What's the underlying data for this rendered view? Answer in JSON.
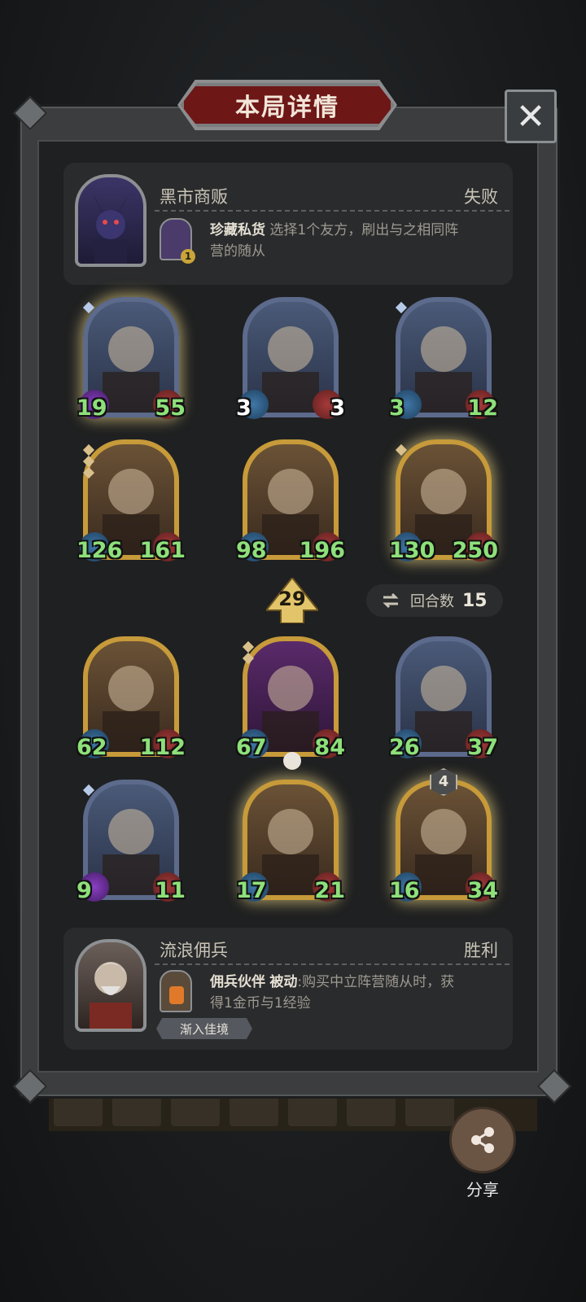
{
  "title": "本局详情",
  "close_label": "✕",
  "opponent": {
    "name": "黑市商贩",
    "result": "失败",
    "power_name": "珍藏私货",
    "power_desc_line1": "选择1个友方，刷出与之相同阵",
    "power_desc_line2": "营的随从",
    "power_badge": "1"
  },
  "board_top": [
    {
      "atk": "19",
      "hp": "55",
      "frame": "silver",
      "glow": true,
      "atk_style": "purple",
      "diamonds": 1
    },
    {
      "atk": "3",
      "hp": "3",
      "frame": "silver",
      "glow": false,
      "atk_style": "blue",
      "atk_white": true,
      "hp_white": true,
      "diamonds": 0
    },
    {
      "atk": "3",
      "hp": "12",
      "frame": "silver",
      "glow": false,
      "atk_style": "red",
      "diamonds": 1
    },
    {
      "atk": "126",
      "hp": "161",
      "frame": "gold",
      "glow": false,
      "diamonds": 3
    },
    {
      "atk": "98",
      "hp": "196",
      "frame": "gold",
      "glow": false,
      "diamonds": 0
    },
    {
      "atk": "130",
      "hp": "250",
      "frame": "gold",
      "glow": true,
      "diamonds": 1
    }
  ],
  "tier": "29",
  "turns": {
    "label": "回合数",
    "value": "15"
  },
  "board_bottom": [
    {
      "atk": "62",
      "hp": "112",
      "frame": "gold",
      "glow": false,
      "diamonds": 0
    },
    {
      "atk": "67",
      "hp": "84",
      "frame": "purple",
      "glow": false,
      "diamonds": 2
    },
    {
      "atk": "26",
      "hp": "37",
      "frame": "silver",
      "glow": false,
      "diamonds": 0
    },
    {
      "atk": "9",
      "hp": "11",
      "frame": "silver",
      "glow": false,
      "atk_style": "purple",
      "diamonds": 1
    },
    {
      "atk": "17",
      "hp": "21",
      "frame": "gold",
      "glow": true,
      "diamonds": 0
    },
    {
      "atk": "16",
      "hp": "34",
      "frame": "gold",
      "glow": true,
      "diamonds": 0,
      "shield": "4"
    }
  ],
  "player": {
    "name": "流浪佣兵",
    "result": "胜利",
    "power_name": "佣兵伙伴",
    "power_type": "被动",
    "power_desc_line1": ":购买中立阵营随从时，获",
    "power_desc_line2": "得1金币与1经验",
    "tag": "渐入佳境"
  },
  "share_label": "分享"
}
